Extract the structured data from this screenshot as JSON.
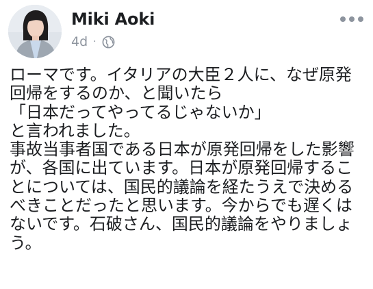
{
  "post": {
    "author": "Miki Aoki",
    "time": "4d",
    "separator": "·",
    "privacy_icon": "globe-icon",
    "more_icon": "more-options-icon",
    "lines": [
      "ローマです。イタリアの大臣２人に、なぜ原発",
      "回帰をするのか、と聞いたら",
      "「日本だってやってるじゃないか」",
      "と言われました。",
      "事故当事者国である日本が原発回帰をした影響",
      "が、各国に出ています。日本が原発回帰するこ",
      "とについては、国民的議論を経たうえで決める",
      "べきことだったと思います。今からでも遅くは",
      "ないです。石破さん、国民的議論をやりましょ",
      "う。"
    ]
  },
  "colors": {
    "text": "#1c1e21",
    "meta": "#8d949e"
  }
}
